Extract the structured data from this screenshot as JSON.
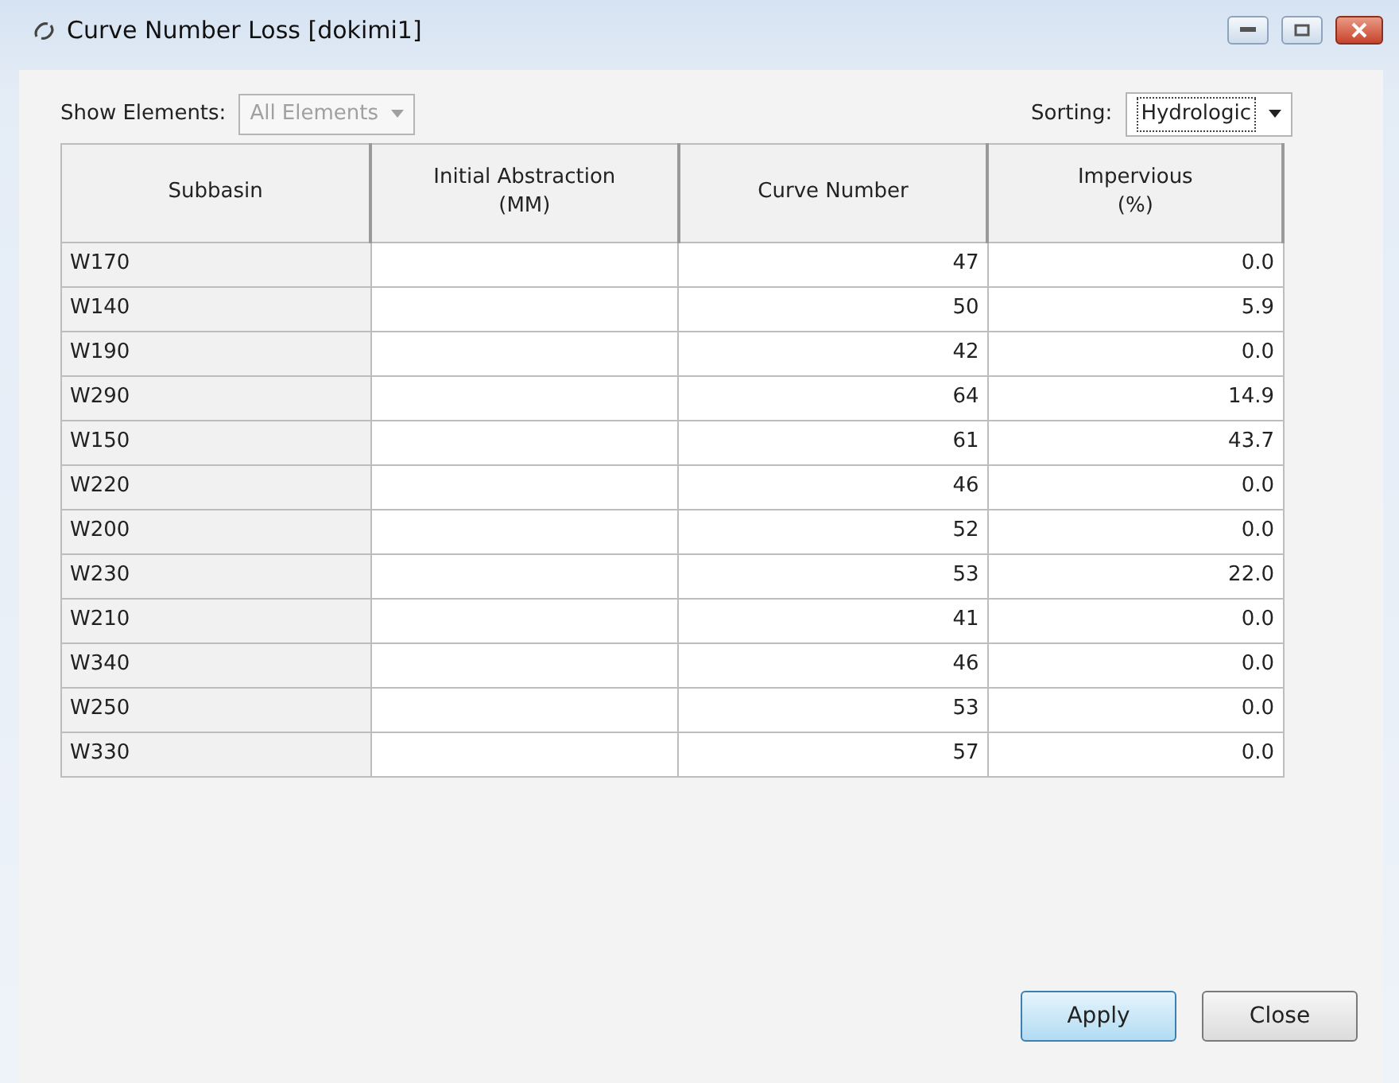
{
  "window": {
    "title": "Curve Number Loss [dokimi1]"
  },
  "show_elements": {
    "label": "Show Elements:",
    "value": "All Elements",
    "disabled": true
  },
  "sorting": {
    "label": "Sorting:",
    "value": "Hydrologic",
    "disabled": false
  },
  "table": {
    "columns": [
      "Subbasin",
      "Initial Abstraction\n(MM)",
      "Curve Number",
      "Impervious\n(%)"
    ],
    "rows": [
      [
        "W170",
        "",
        "47",
        "0.0"
      ],
      [
        "W140",
        "",
        "50",
        "5.9"
      ],
      [
        "W190",
        "",
        "42",
        "0.0"
      ],
      [
        "W290",
        "",
        "64",
        "14.9"
      ],
      [
        "W150",
        "",
        "61",
        "43.7"
      ],
      [
        "W220",
        "",
        "46",
        "0.0"
      ],
      [
        "W200",
        "",
        "52",
        "0.0"
      ],
      [
        "W230",
        "",
        "53",
        "22.0"
      ],
      [
        "W210",
        "",
        "41",
        "0.0"
      ],
      [
        "W340",
        "",
        "46",
        "0.0"
      ],
      [
        "W250",
        "",
        "53",
        "0.0"
      ],
      [
        "W330",
        "",
        "57",
        "0.0"
      ]
    ]
  },
  "buttons": [
    {
      "label": "Apply",
      "default": true
    },
    {
      "label": "Close",
      "default": false
    }
  ]
}
